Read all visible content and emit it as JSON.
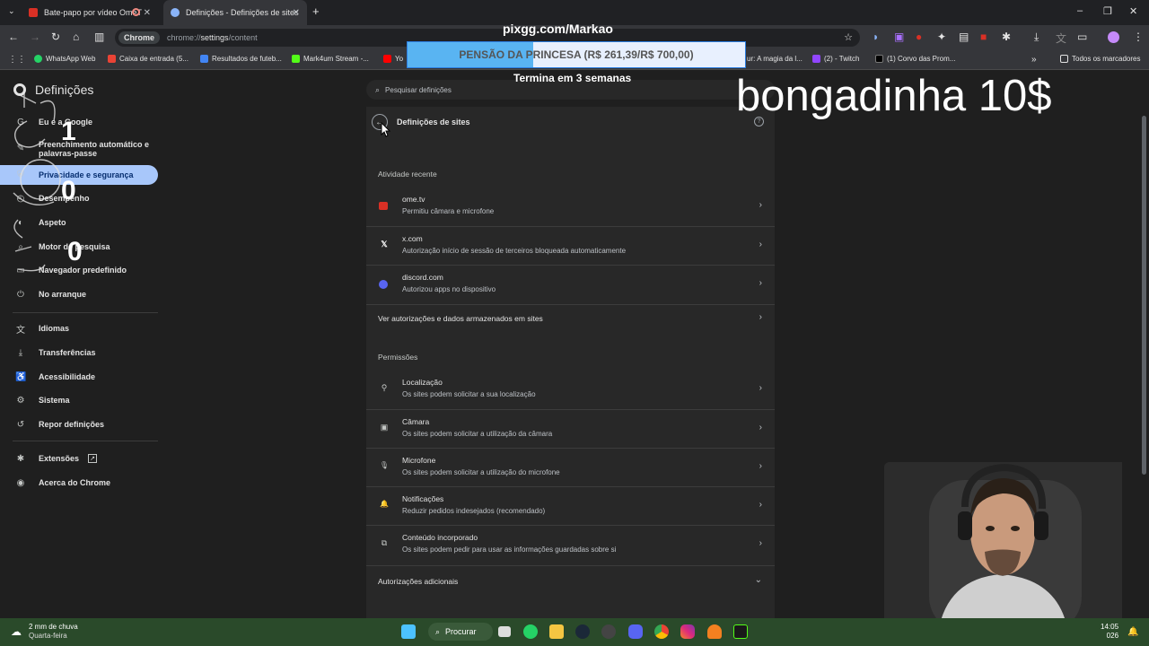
{
  "tabs": [
    {
      "title": "Bate-papo por vídeo OmeT",
      "active": false
    },
    {
      "title": "Definições - Definições de sites",
      "active": true
    }
  ],
  "toolbar": {
    "chip": "Chrome",
    "url_prefix": "chrome://",
    "url_main": "settings",
    "url_suffix": "/content"
  },
  "bookmarks": {
    "items": [
      "WhatsApp Web",
      "Caixa de entrada (5...",
      "Resultados de futeb...",
      "Mark4um Stream -...",
      "Yo",
      "ur: A magia da l...",
      "(2) - Twitch",
      "(1) Corvo das Prom..."
    ],
    "all": "Todos os marcadores"
  },
  "settings": {
    "brand": "Definições",
    "search_placeholder": "Pesquisar definições",
    "nav": [
      {
        "label": "Eu e a Google",
        "icon": "G"
      },
      {
        "label": "Preenchimento automático e palavras-passe",
        "icon": "✎"
      },
      {
        "label": "Privacidade e segurança",
        "icon": "⛨"
      },
      {
        "label": "Desempenho",
        "icon": "◴"
      },
      {
        "label": "Aspeto",
        "icon": "◐"
      },
      {
        "label": "Motor de pesquisa",
        "icon": "⌕"
      },
      {
        "label": "Navegador predefinido",
        "icon": "▭"
      },
      {
        "label": "No arranque",
        "icon": "⏻"
      },
      {
        "label": "Idiomas",
        "icon": "文"
      },
      {
        "label": "Transferências",
        "icon": "⤓"
      },
      {
        "label": "Acessibilidade",
        "icon": "♿"
      },
      {
        "label": "Sistema",
        "icon": "⚙"
      },
      {
        "label": "Repor definições",
        "icon": "↺"
      },
      {
        "label": "Extensões",
        "icon": "✱"
      },
      {
        "label": "Acerca do Chrome",
        "icon": "◉"
      }
    ],
    "panel_title": "Definições de sites",
    "recent_header": "Atividade recente",
    "recent": [
      {
        "site": "ome.tv",
        "desc": "Permitiu câmara e microfone",
        "color": "#d93025"
      },
      {
        "site": "x.com",
        "desc": "Autorização início de sessão de terceiros bloqueada automaticamente",
        "color": "#000000"
      },
      {
        "site": "discord.com",
        "desc": "Autorizou apps no dispositivo",
        "color": "#5865f2"
      }
    ],
    "view_all": "Ver autorizações e dados armazenados em sites",
    "perm_header": "Permissões",
    "permissions": [
      {
        "name": "Localização",
        "desc": "Os sites podem solicitar a sua localização",
        "icon": "⚲"
      },
      {
        "name": "Câmara",
        "desc": "Os sites podem solicitar a utilização da câmara",
        "icon": "▣"
      },
      {
        "name": "Microfone",
        "desc": "Os sites podem solicitar a utilização do microfone",
        "icon": "🎙"
      },
      {
        "name": "Notificações",
        "desc": "Reduzir pedidos indesejados (recomendado)",
        "icon": "🔔"
      },
      {
        "name": "Conteúdo incorporado",
        "desc": "Os sites podem pedir para usar as informações guardadas sobre si",
        "icon": "⧉"
      }
    ],
    "additional": "Autorizações adicionais"
  },
  "overlay": {
    "site": "pixgg.com/Markao",
    "goal_text": "PENSÃO DA PRINCESA (R$ 261,39/R$ 700,00)",
    "goal_fraction": 0.373,
    "weeks": "Termina em 3 semanas",
    "big": "bongadinha 10$",
    "counters": [
      "1",
      "0",
      "0"
    ]
  },
  "taskbar": {
    "weather_line1": "2 mm de chuva",
    "weather_line2": "Quarta-feira",
    "search": "Procurar",
    "time": "14:05",
    "date": "026"
  }
}
